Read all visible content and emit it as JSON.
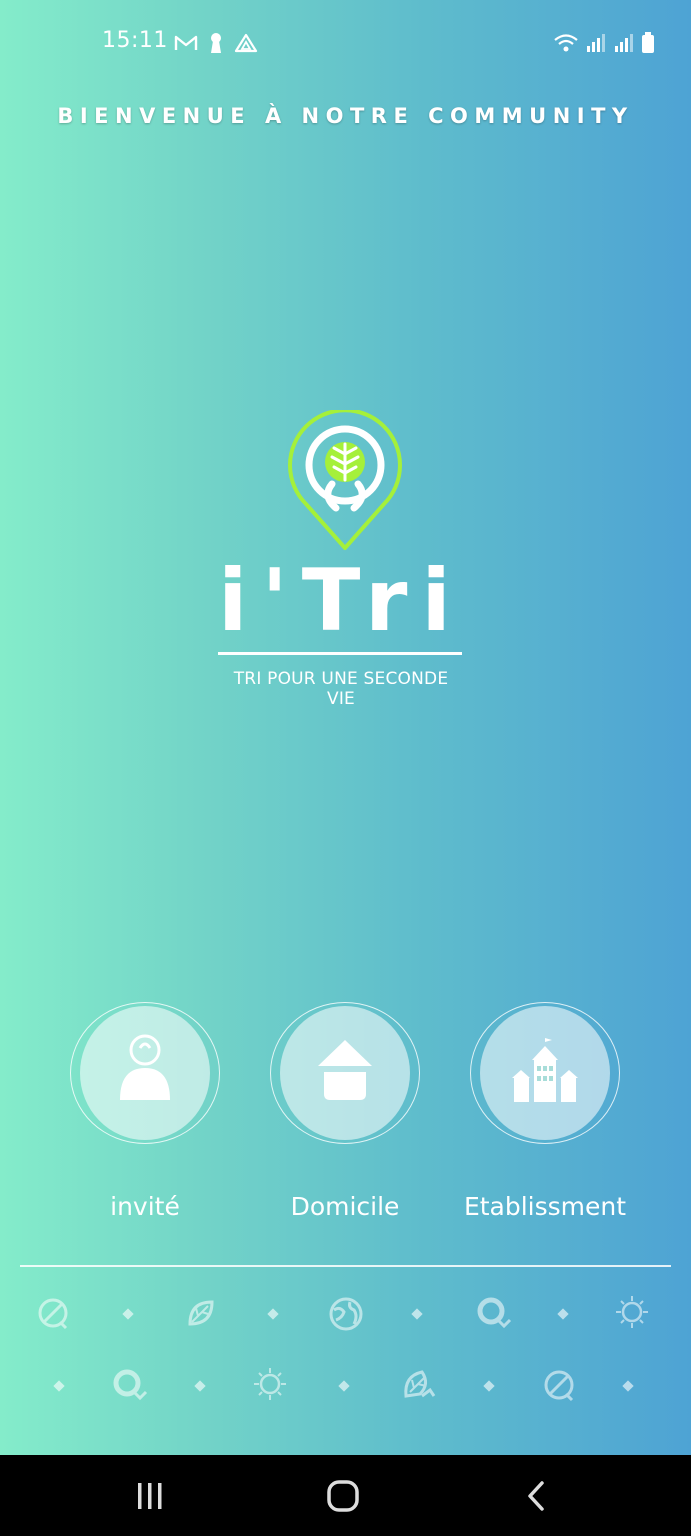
{
  "status_bar": {
    "time": "15:11",
    "left_icons": [
      "gmail-icon",
      "keyhole-icon",
      "drive-icon"
    ],
    "right_icons": [
      "wifi-icon",
      "signal-icon",
      "signal-icon",
      "battery-icon"
    ]
  },
  "header": {
    "welcome": "BIENVENUE À NOTRE COMMUNITY"
  },
  "logo": {
    "name": "i'Tri",
    "tagline": "TRI POUR UNE SECONDE VIE",
    "colors": {
      "pin": "#a5f03a",
      "leaf": "#a5f03a"
    }
  },
  "choices": [
    {
      "label": "invité",
      "icon": "guest-icon"
    },
    {
      "label": "Domicile",
      "icon": "home-icon"
    },
    {
      "label": "Etablissment",
      "icon": "building-icon"
    }
  ],
  "decor": {
    "row1": [
      "leaf-circle-icon",
      "leaf-icon",
      "globe-icon",
      "magnifier-icon",
      "bulb-icon"
    ],
    "row2": [
      "magnifier-icon",
      "bulb-icon",
      "hand-leaf-icon",
      "leaf-circle-icon"
    ]
  },
  "nav": [
    "recent-apps-button",
    "home-button",
    "back-button"
  ],
  "theme": {
    "gradient_start": "#84ecca",
    "gradient_end": "#4ea3d4"
  }
}
